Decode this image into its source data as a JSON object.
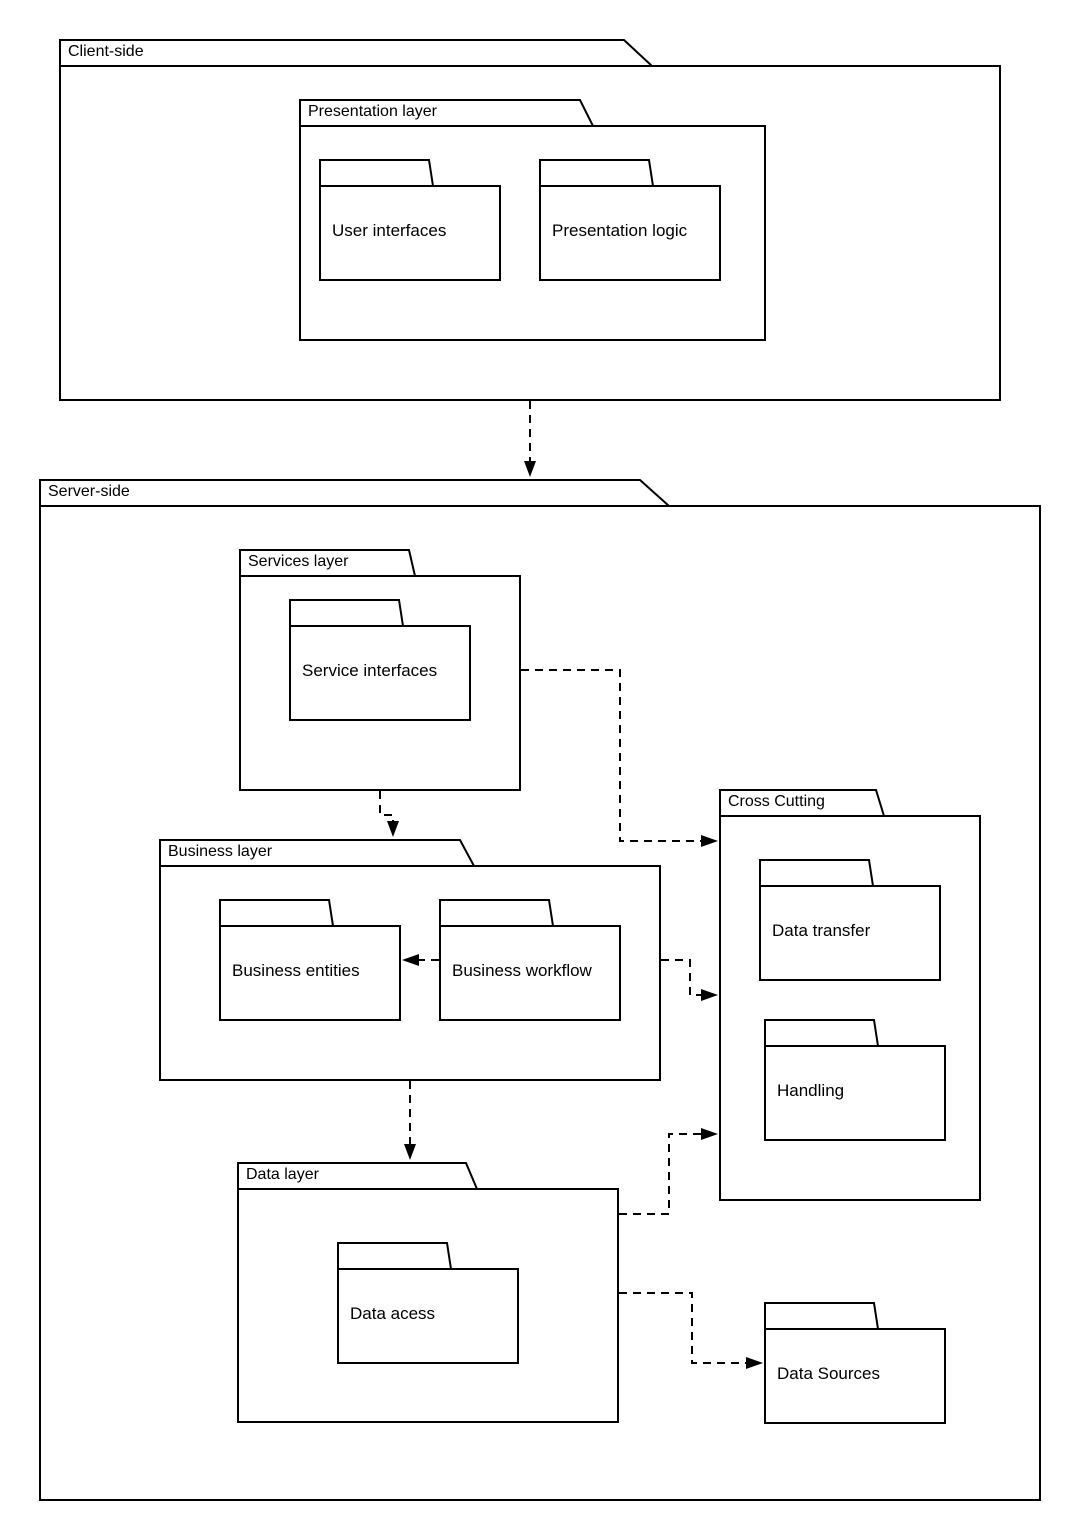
{
  "diagram": {
    "type": "UML package diagram",
    "packages": {
      "client_side": {
        "label": "Client-side"
      },
      "presentation_layer": {
        "label": "Presentation layer"
      },
      "user_interfaces": {
        "label": "User interfaces"
      },
      "presentation_logic": {
        "label": "Presentation logic"
      },
      "server_side": {
        "label": "Server-side"
      },
      "services_layer": {
        "label": "Services layer"
      },
      "service_interfaces": {
        "label": "Service interfaces"
      },
      "business_layer": {
        "label": "Business layer"
      },
      "business_entities": {
        "label": "Business entities"
      },
      "business_workflow": {
        "label": "Business workflow"
      },
      "data_layer": {
        "label": "Data layer"
      },
      "data_access": {
        "label": "Data acess"
      },
      "cross_cutting": {
        "label": "Cross Cutting"
      },
      "data_transfer": {
        "label": "Data transfer"
      },
      "handling": {
        "label": "Handling"
      },
      "data_sources": {
        "label": "Data Sources"
      }
    },
    "dependencies": [
      {
        "from": "Client-side",
        "to": "Server-side",
        "style": "dashed"
      },
      {
        "from": "Services layer",
        "to": "Business layer",
        "style": "dashed"
      },
      {
        "from": "Services layer",
        "to": "Cross Cutting",
        "style": "dashed"
      },
      {
        "from": "Business workflow",
        "to": "Business entities",
        "style": "dashed"
      },
      {
        "from": "Business layer",
        "to": "Cross Cutting",
        "style": "dashed"
      },
      {
        "from": "Business layer",
        "to": "Data layer",
        "style": "dashed"
      },
      {
        "from": "Data layer",
        "to": "Cross Cutting",
        "style": "dashed"
      },
      {
        "from": "Data layer",
        "to": "Data Sources",
        "style": "dashed"
      }
    ]
  }
}
